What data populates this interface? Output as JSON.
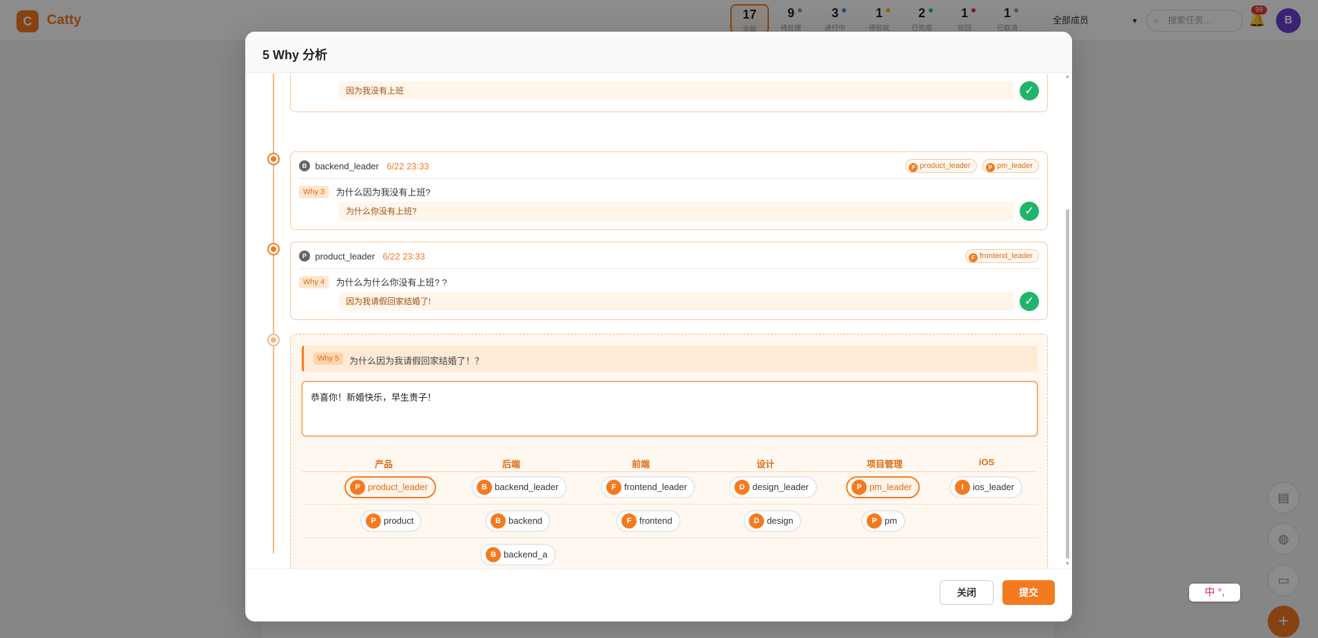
{
  "app": {
    "logo_letter": "C",
    "name": "Catty",
    "stats": [
      {
        "num": "17",
        "label": "全部",
        "dot": ""
      },
      {
        "num": "9",
        "label": "待处理",
        "dot": "#999999"
      },
      {
        "num": "3",
        "label": "进行中",
        "dot": "#3b82f6"
      },
      {
        "num": "1",
        "label": "待验收",
        "dot": "#f5b400"
      },
      {
        "num": "2",
        "label": "已完成",
        "dot": "#22c55e"
      },
      {
        "num": "1",
        "label": "驳回",
        "dot": "#e53935"
      },
      {
        "num": "1",
        "label": "已取消",
        "dot": "#999999"
      }
    ],
    "member_select": "全部成员",
    "search_placeholder": "搜索任务...",
    "notification_count": "99",
    "avatar_letter": "B"
  },
  "modal": {
    "title": "5 Why 分析",
    "close_label": "关闭",
    "submit_label": "提交"
  },
  "entries": [
    {
      "answer": "因为我没有上班"
    },
    {
      "avatar": "B",
      "avatar_color": "#555555",
      "author": "backend_leader",
      "time": "6/22 23:33",
      "tags": [
        {
          "letter": "P",
          "name": "product_leader"
        },
        {
          "letter": "P",
          "name": "pm_leader"
        }
      ],
      "why": "Why 3",
      "question": "为什么因为我没有上班?",
      "answer": "为什么你没有上班?"
    },
    {
      "avatar": "P",
      "avatar_color": "#555555",
      "author": "product_leader",
      "time": "6/22 23:33",
      "tags": [
        {
          "letter": "F",
          "name": "frontend_leader"
        }
      ],
      "why": "Why 4",
      "question": "为什么为什么你没有上班? ?",
      "answer": "因为我请假回家结婚了!"
    }
  ],
  "current": {
    "why": "Why 5",
    "question": "为什么因为我请假回家结婚了！？",
    "answer_value": "恭喜你！新婚快乐，早生贵子！",
    "departments": [
      {
        "name": "产品",
        "users": [
          {
            "letter": "P",
            "name": "product_leader",
            "selected": true
          },
          {
            "letter": "P",
            "name": "product",
            "selected": false
          }
        ]
      },
      {
        "name": "后端",
        "users": [
          {
            "letter": "B",
            "name": "backend_leader",
            "selected": false
          },
          {
            "letter": "B",
            "name": "backend",
            "selected": false
          },
          {
            "letter": "B",
            "name": "backend_a",
            "selected": false
          }
        ]
      },
      {
        "name": "前端",
        "users": [
          {
            "letter": "F",
            "name": "frontend_leader",
            "selected": false
          },
          {
            "letter": "F",
            "name": "frontend",
            "selected": false
          }
        ]
      },
      {
        "name": "设计",
        "users": [
          {
            "letter": "D",
            "name": "design_leader",
            "selected": false
          },
          {
            "letter": "D",
            "name": "design",
            "selected": false
          }
        ]
      },
      {
        "name": "项目管理",
        "users": [
          {
            "letter": "P",
            "name": "pm_leader",
            "selected": true
          },
          {
            "letter": "P",
            "name": "pm",
            "selected": false
          }
        ]
      },
      {
        "name": "iOS",
        "users": [
          {
            "letter": "I",
            "name": "ios_leader",
            "selected": false
          }
        ]
      }
    ]
  },
  "ime_label": "中 °,",
  "colors": {
    "accent": "#f47a1f",
    "success": "#20b46a"
  }
}
